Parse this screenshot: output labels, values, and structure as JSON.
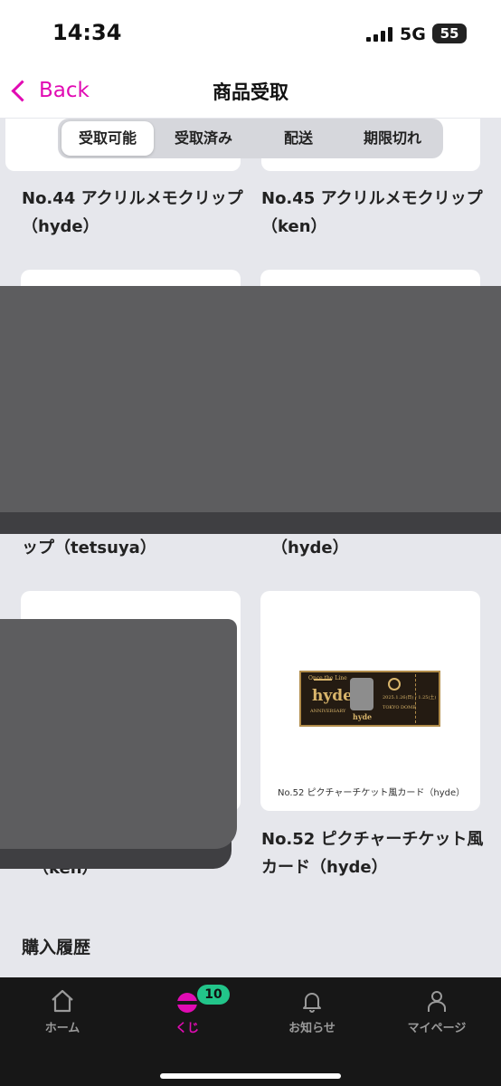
{
  "status": {
    "time": "14:34",
    "network": "5G",
    "battery": "55"
  },
  "nav": {
    "back_label": "Back",
    "title": "商品受取"
  },
  "segments": [
    "受取可能",
    "受取済み",
    "配送",
    "期限切れ"
  ],
  "items": [
    {
      "title": "No.44 アクリルメモクリップ（hyde）"
    },
    {
      "title": "No.45 アクリルメモクリップ（ken）"
    },
    {
      "title_visible": "ップ（tetsuya）"
    },
    {
      "title_visible": "（hyde）"
    },
    {
      "title_visible": "（ken）"
    },
    {
      "title": "No.52 ピクチャーチケット風カード（hyde）",
      "caption": "No.52 ピクチャーチケット風カード（hyde）"
    }
  ],
  "ticket": {
    "top_text": "Once the Line",
    "brand": "hyde",
    "sub_brand": "ANNIVERSARY",
    "name_tag": "hyde",
    "date": "2025.1.26(日)・1.25(土)",
    "venue": "TOKYO DOME"
  },
  "history_heading": "購入履歴",
  "tabs": [
    {
      "label": "ホーム",
      "icon": "home-icon"
    },
    {
      "label": "くじ",
      "icon": "kuji-icon"
    },
    {
      "label": "お知らせ",
      "icon": "bell-icon"
    },
    {
      "label": "マイページ",
      "icon": "person-icon"
    }
  ],
  "kuji_badge": "10",
  "colors": {
    "accent": "#e10bb3",
    "badge": "#22c58a",
    "tabbar": "#171717",
    "background": "#e6e7ec"
  }
}
